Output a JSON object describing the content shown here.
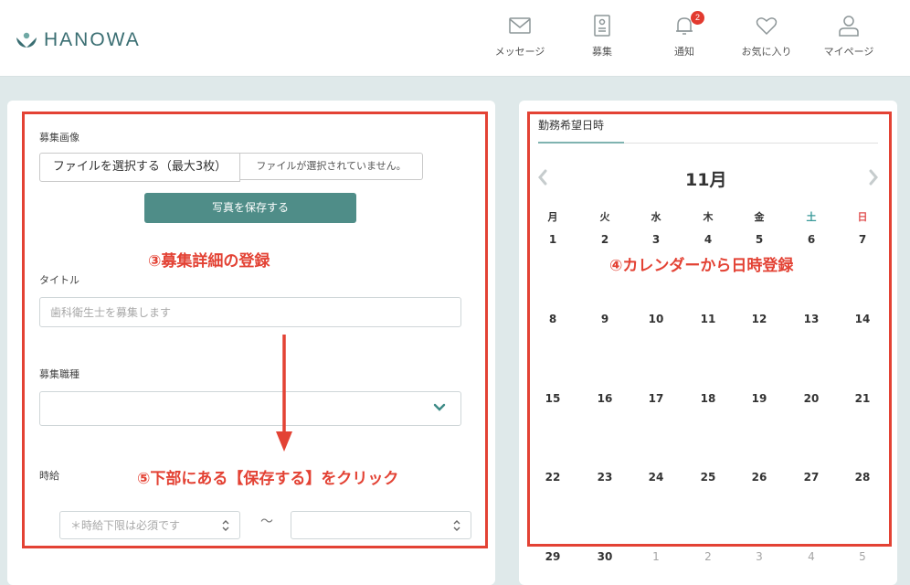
{
  "header": {
    "logo_text": "HANOWA",
    "nav": [
      {
        "label": "メッセージ",
        "icon": "envelope-icon"
      },
      {
        "label": "募集",
        "icon": "document-icon"
      },
      {
        "label": "通知",
        "icon": "bell-icon",
        "badge": "2"
      },
      {
        "label": "お気に入り",
        "icon": "heart-icon"
      },
      {
        "label": "マイページ",
        "icon": "user-icon"
      }
    ]
  },
  "form": {
    "image_label": "募集画像",
    "file_button": "ファイルを選択する（最大3枚）",
    "file_status": "ファイルが選択されていません。",
    "save_photo_button": "写真を保存する",
    "title_label": "タイトル",
    "title_placeholder": "歯科衛生士を募集します",
    "job_type_label": "募集職種",
    "hourly_label": "時給",
    "wage_min_placeholder": "＊時給下限は必須です",
    "range_separator": "〜"
  },
  "annotations": {
    "form_note": "③募集詳細の登録",
    "calendar_note": "④カレンダーから日時登録",
    "save_note": "⑤下部にある【保存する】をクリック"
  },
  "calendar": {
    "tab": "勤務希望日時",
    "month": "11月",
    "weekdays": [
      "月",
      "火",
      "水",
      "木",
      "金",
      "土",
      "日"
    ],
    "weeks": [
      [
        "1",
        "2",
        "3",
        "4",
        "5",
        "6",
        "7"
      ],
      [
        "8",
        "9",
        "10",
        "11",
        "12",
        "13",
        "14"
      ],
      [
        "15",
        "16",
        "17",
        "18",
        "19",
        "20",
        "21"
      ],
      [
        "22",
        "23",
        "24",
        "25",
        "26",
        "27",
        "28"
      ],
      [
        "29",
        "30",
        "1",
        "2",
        "3",
        "4",
        "5"
      ]
    ]
  },
  "colors": {
    "accent": "#4f8d88",
    "annotation": "#e34234",
    "saturday": "#3a9a9a",
    "sunday": "#e05050"
  }
}
